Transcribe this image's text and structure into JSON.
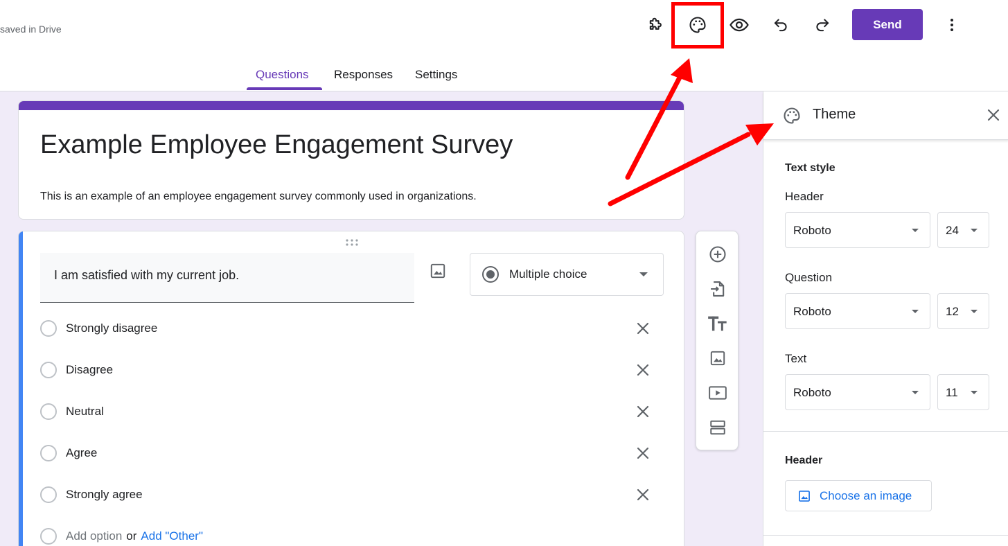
{
  "header": {
    "saved_status": "saved in Drive",
    "send_label": "Send",
    "icons": [
      "puzzle-icon",
      "palette-icon",
      "eye-icon",
      "undo-icon",
      "redo-icon",
      "more-vert-icon"
    ]
  },
  "tabs": [
    {
      "label": "Questions",
      "active": true
    },
    {
      "label": "Responses",
      "active": false
    },
    {
      "label": "Settings",
      "active": false
    }
  ],
  "form": {
    "title": "Example Employee Engagement Survey",
    "description": "This is an example of an employee engagement survey commonly used in organizations."
  },
  "question": {
    "text": "I am satisfied with my current job.",
    "type": "Multiple choice",
    "options": [
      "Strongly disagree",
      "Disagree",
      "Neutral",
      "Agree",
      "Strongly agree"
    ],
    "add_option": "Add option",
    "or_label": "or",
    "add_other": "Add \"Other\""
  },
  "toolbar": {
    "tools": [
      "add-question-icon",
      "import-questions-icon",
      "add-title-icon",
      "add-image-icon",
      "add-video-icon",
      "add-section-icon"
    ]
  },
  "theme_panel": {
    "title": "Theme",
    "text_style_title": "Text style",
    "header_label": "Header",
    "header_font": "Roboto",
    "header_size": "24",
    "question_label": "Question",
    "question_font": "Roboto",
    "question_size": "12",
    "text_label": "Text",
    "text_font": "Roboto",
    "text_size": "11",
    "header_section_title": "Header",
    "choose_image_label": "Choose an image"
  },
  "colors": {
    "accent": "#673ab7",
    "background": "#f0ebf8",
    "question_accent": "#4285f4",
    "link": "#1a73e8",
    "annotation": "#ff0000"
  }
}
